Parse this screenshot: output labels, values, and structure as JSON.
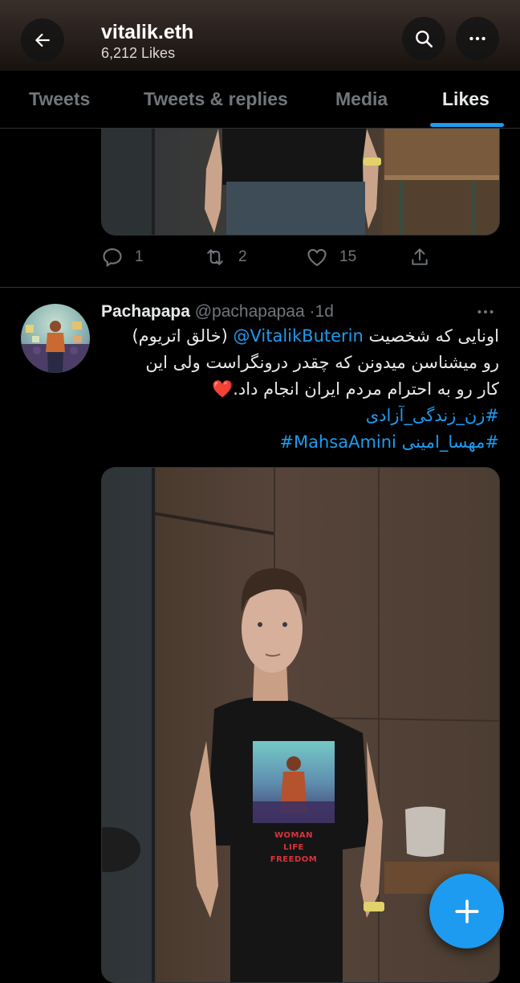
{
  "header": {
    "title": "vitalik.eth",
    "subtitle": "6,212 Likes"
  },
  "tabs": [
    {
      "label": "Tweets"
    },
    {
      "label": "Tweets & replies"
    },
    {
      "label": "Media"
    },
    {
      "label": "Likes",
      "active": true
    }
  ],
  "tweet1": {
    "replies": "1",
    "retweets": "2",
    "likes": "15"
  },
  "tweet2": {
    "name": "Pachapapa",
    "handle": "@pachapapaa",
    "separator": "·",
    "time": "1d",
    "mention": "@VitalikButerin",
    "line1_before": "اونایی که شخصیت",
    "line1_after": "(خالق اتریوم)",
    "line2": "رو میشناسن میدونن که چقدر درونگراست ولی این",
    "line3": "کار رو به احترام مردم ایران انجام داد.",
    "emoji": "❤️",
    "hashtag1": "#زن_زندگی_آزادی",
    "hashtag2": "#مهسا_امینی",
    "hashtag3": "#MahsaAmini",
    "shirt_lines": [
      "WOMAN",
      "LIFE",
      "FREEDOM"
    ]
  },
  "icons": {
    "back": "arrow-left-icon",
    "search": "search-icon",
    "more": "more-icon",
    "reply": "reply-icon",
    "retweet": "retweet-icon",
    "like": "heart-icon",
    "share": "share-icon",
    "compose": "plus-icon"
  },
  "colors": {
    "accent": "#1d9bf0",
    "background": "#000000",
    "text": "#e7e9ea",
    "muted": "#71767b",
    "border": "#2f3336"
  }
}
